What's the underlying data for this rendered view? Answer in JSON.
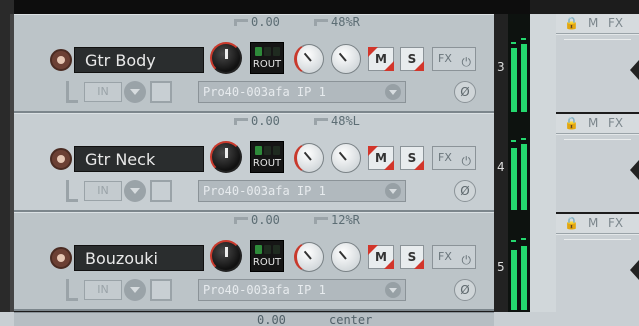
{
  "tracks": [
    {
      "name": "Gtr Body",
      "volume": "0.00",
      "pan": "48%R",
      "route": "ROUT",
      "mute": "M",
      "solo": "S",
      "fx": "FX",
      "in": "IN",
      "input": "Pro40-003afa IP 1",
      "number": "3",
      "phase": "Ø"
    },
    {
      "name": "Gtr Neck",
      "volume": "0.00",
      "pan": "48%L",
      "route": "ROUT",
      "mute": "M",
      "solo": "S",
      "fx": "FX",
      "in": "IN",
      "input": "Pro40-003afa IP 1",
      "number": "4",
      "phase": "Ø"
    },
    {
      "name": "Bouzouki",
      "volume": "0.00",
      "pan": "12%R",
      "route": "ROUT",
      "mute": "M",
      "solo": "S",
      "fx": "FX",
      "in": "IN",
      "input": "Pro40-003afa IP 1",
      "number": "5",
      "phase": "Ø"
    }
  ],
  "next_track": {
    "volume": "0.00",
    "pan": "center"
  },
  "lane_header": {
    "lock": "🔒",
    "mute": "M",
    "fx": "FX"
  },
  "colors": {
    "meter": "#24d86e",
    "record": "#6c4034",
    "accent_red": "#d2352a"
  }
}
